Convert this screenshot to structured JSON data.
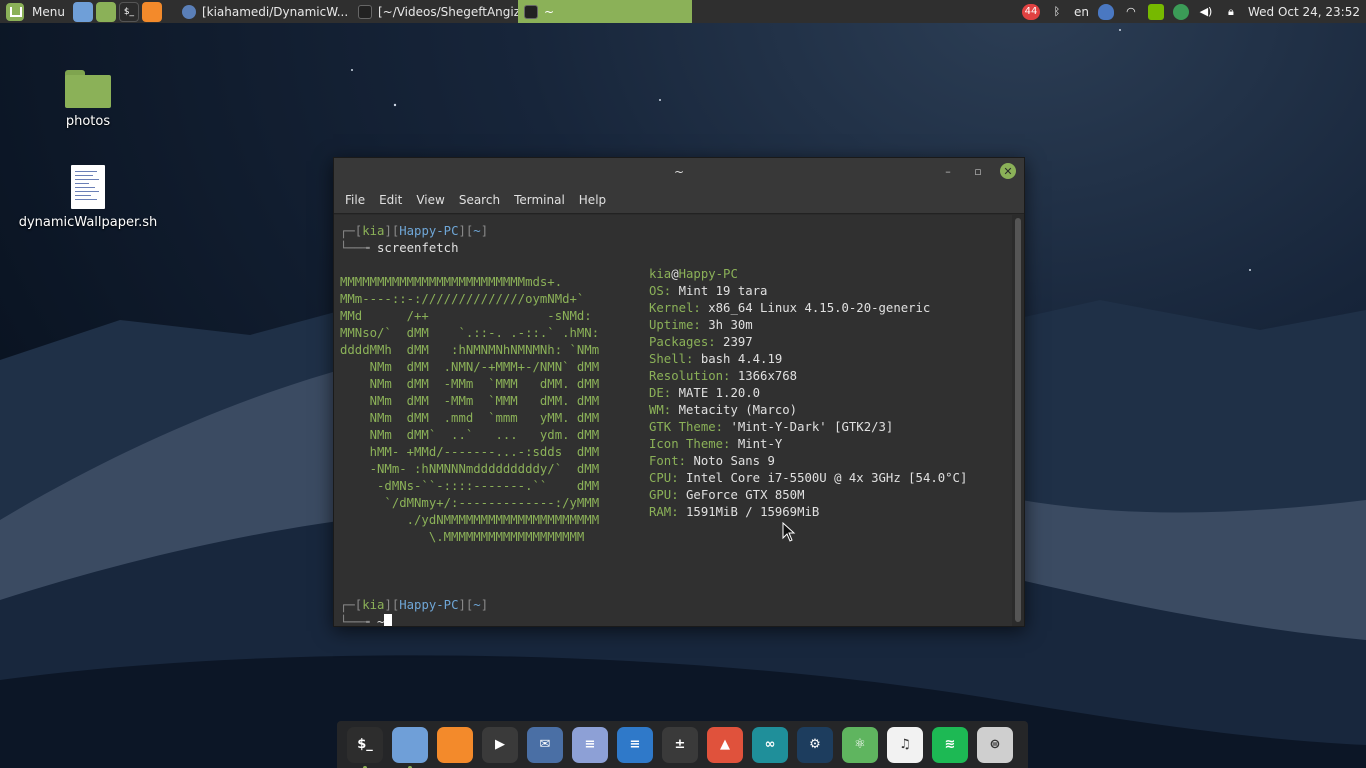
{
  "top_panel": {
    "menu_label": "Menu",
    "tasks": [
      {
        "label": "[kiahamedi/DynamicW..."
      },
      {
        "label": "[~/Videos/ShegeftAngiz..."
      },
      {
        "label": "~"
      }
    ],
    "tray": {
      "notification_count": "44",
      "language": "en",
      "clock": "Wed Oct 24, 23:52"
    }
  },
  "desktop_icons": [
    {
      "label": "photos",
      "icon": "folder-icon"
    },
    {
      "label": "dynamicWallpaper.sh",
      "icon": "text-document-icon"
    }
  ],
  "terminal": {
    "title": "~",
    "menu": [
      "File",
      "Edit",
      "View",
      "Search",
      "Terminal",
      "Help"
    ],
    "prompt": {
      "user": "kia",
      "host": "Happy-PC",
      "dir": "~"
    },
    "command": "screenfetch",
    "ascii_art": [
      "MMMMMMMMMMMMMMMMMMMMMMMMMmds+.",
      "MMm----::-://////////////oymNMd+`",
      "MMd      /++                -sNMd:",
      "MMNso/`  dMM    `.::-. .-::.` .hMN:",
      "ddddMMh  dMM   :hNMNMNhNMNMNh: `NMm",
      "    NMm  dMM  .NMN/-+MMM+-/NMN` dMM",
      "    NMm  dMM  -MMm  `MMM   dMM. dMM",
      "    NMm  dMM  -MMm  `MMM   dMM. dMM",
      "    NMm  dMM  .mmd  `mmm   yMM. dMM",
      "    NMm  dMM`  ..`   ...   ydm. dMM",
      "    hMM- +MMd/-------...-:sdds  dMM",
      "    -NMm- :hNMNNNmdddddddddy/`  dMM",
      "     -dMNs-``-::::-------.``    dMM",
      "      `/dMNmy+/:-------------:/yMMM",
      "         ./ydNMMMMMMMMMMMMMMMMMMMMM",
      "            \\.MMMMMMMMMMMMMMMMMMM"
    ],
    "user_host": {
      "user": "kia",
      "at": "@",
      "host": "Happy-PC"
    },
    "info": [
      {
        "label": "OS:",
        "value": "Mint 19 tara"
      },
      {
        "label": "Kernel:",
        "value": "x86_64 Linux 4.15.0-20-generic"
      },
      {
        "label": "Uptime:",
        "value": "3h 30m"
      },
      {
        "label": "Packages:",
        "value": "2397"
      },
      {
        "label": "Shell:",
        "value": "bash 4.4.19"
      },
      {
        "label": "Resolution:",
        "value": "1366x768"
      },
      {
        "label": "DE:",
        "value": "MATE 1.20.0"
      },
      {
        "label": "WM:",
        "value": "Metacity (Marco)"
      },
      {
        "label": "GTK Theme:",
        "value": "'Mint-Y-Dark' [GTK2/3]"
      },
      {
        "label": "Icon Theme:",
        "value": "Mint-Y"
      },
      {
        "label": "Font:",
        "value": "Noto Sans 9"
      },
      {
        "label": "CPU:",
        "value": "Intel Core i7-5500U @ 4x 3GHz [54.0°C]"
      },
      {
        "label": "GPU:",
        "value": "GeForce GTX 850M"
      },
      {
        "label": "RAM:",
        "value": "1591MiB / 15969MiB"
      }
    ],
    "second_prompt_path": "~"
  },
  "dock": {
    "items": [
      {
        "name": "terminal",
        "icon": "terminal-icon",
        "glyph": "$_",
        "color": "#2d2d2d"
      },
      {
        "name": "chromium",
        "icon": "chromium-icon",
        "glyph": "",
        "color": "#6f9fd8"
      },
      {
        "name": "firefox",
        "icon": "firefox-icon",
        "glyph": "",
        "color": "#f38a2b"
      },
      {
        "name": "media-player",
        "icon": "play-icon",
        "glyph": "▶",
        "color": "#3a3a3a"
      },
      {
        "name": "mail",
        "icon": "mail-icon",
        "glyph": "✉",
        "color": "#4a6fa5"
      },
      {
        "name": "text-editor",
        "icon": "text-editor-icon",
        "glyph": "≡",
        "color": "#8da0d6"
      },
      {
        "name": "writer",
        "icon": "document-icon",
        "glyph": "≡",
        "color": "#2f79c9"
      },
      {
        "name": "calculator",
        "icon": "calculator-icon",
        "glyph": "±",
        "color": "#3a3a3a"
      },
      {
        "name": "image-viewer",
        "icon": "photo-icon",
        "glyph": "▲",
        "color": "#e0523c"
      },
      {
        "name": "arduino",
        "icon": "arduino-icon",
        "glyph": "∞",
        "color": "#1f8f9a"
      },
      {
        "name": "steam",
        "icon": "steam-icon",
        "glyph": "⚙",
        "color": "#1d3d5e"
      },
      {
        "name": "atom",
        "icon": "atom-icon",
        "glyph": "⚛",
        "color": "#5fb55f"
      },
      {
        "name": "music",
        "icon": "music-icon",
        "glyph": "♫",
        "color": "#f2f2f2"
      },
      {
        "name": "spotify",
        "icon": "spotify-icon",
        "glyph": "≋",
        "color": "#1db954"
      },
      {
        "name": "settings",
        "icon": "settings-toggle-icon",
        "glyph": "⊜",
        "color": "#cfcfcf"
      }
    ]
  }
}
